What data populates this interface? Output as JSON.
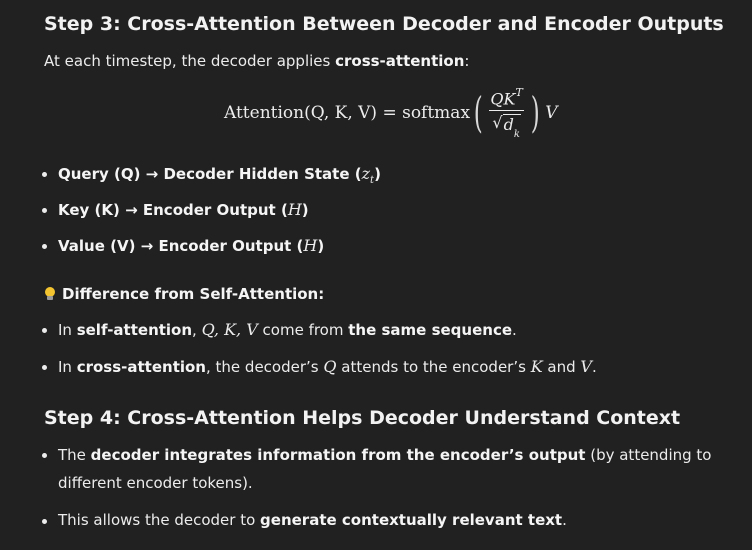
{
  "step3": {
    "heading": "Step 3: Cross-Attention Between Decoder and Encoder Outputs",
    "intro_before": "At each timestep, the decoder applies ",
    "intro_bold": "cross-attention",
    "intro_after": ":"
  },
  "formula": {
    "lhs": "Attention(Q, K, V) = softmax",
    "numerator": "QK",
    "numerator_sup": "T",
    "denominator_var": "d",
    "denominator_sub": "k",
    "rhs": "V"
  },
  "mapping_items": [
    {
      "label": "Query (Q) → Decoder Hidden State (",
      "math": "z",
      "math_sub": "t",
      "end": ")"
    },
    {
      "label": "Key (K) → Encoder Output (",
      "math": "H",
      "end": ")"
    },
    {
      "label": "Value (V) → Encoder Output (",
      "math": "H",
      "end": ")"
    }
  ],
  "difference": {
    "icon": "lightbulb-icon",
    "title": "Difference from Self-Attention:",
    "item1": {
      "pre": "In ",
      "bold1": "self-attention",
      "sep": ", ",
      "math": "Q, K, V",
      "mid": " come from ",
      "bold2": "the same sequence",
      "end": "."
    },
    "item2": {
      "pre": "In ",
      "bold1": "cross-attention",
      "mid1": ", the decoder’s ",
      "math1": "Q",
      "mid2": " attends to the encoder’s ",
      "math2": "K",
      "mid3": " and ",
      "math3": "V",
      "end": "."
    }
  },
  "step4": {
    "heading": "Step 4: Cross-Attention Helps Decoder Understand Context",
    "item1": {
      "pre": "The ",
      "bold": "decoder integrates information from the encoder’s output",
      "post": " (by attending to different encoder tokens)."
    },
    "item2": {
      "pre": "This allows the decoder to ",
      "bold": "generate contextually relevant text",
      "post": "."
    }
  }
}
